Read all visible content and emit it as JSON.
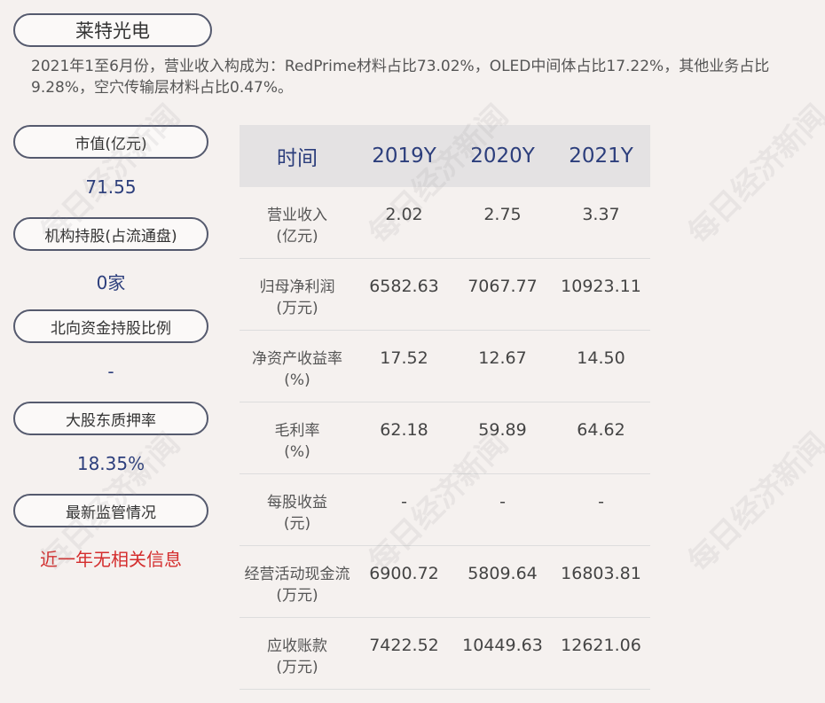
{
  "company": "莱特光电",
  "summary": "2021年1至6月份，营业收入构成为：RedPrime材料占比73.02%，OLED中间体占比17.22%，其他业务占比9.28%，空穴传输层材料占比0.47%。",
  "metrics": [
    {
      "label": "市值(亿元)",
      "value": "71.55"
    },
    {
      "label": "机构持股(占流通盘)",
      "value": "0家"
    },
    {
      "label": "北向资金持股比例",
      "value": "-"
    },
    {
      "label": "大股东质押率",
      "value": "18.35%"
    },
    {
      "label": "最新监管情况",
      "value": "近一年无相关信息"
    }
  ],
  "table": {
    "headers": [
      "时间",
      "2019Y",
      "2020Y",
      "2021Y"
    ],
    "rows": [
      {
        "label1": "营业收入",
        "label2": "(亿元)",
        "v": [
          "2.02",
          "2.75",
          "3.37"
        ]
      },
      {
        "label1": "归母净利润",
        "label2": "(万元)",
        "v": [
          "6582.63",
          "7067.77",
          "10923.11"
        ]
      },
      {
        "label1": "净资产收益率",
        "label2": "(%)",
        "v": [
          "17.52",
          "12.67",
          "14.50"
        ]
      },
      {
        "label1": "毛利率",
        "label2": "(%)",
        "v": [
          "62.18",
          "59.89",
          "64.62"
        ]
      },
      {
        "label1": "每股收益",
        "label2": "(元)",
        "v": [
          "-",
          "-",
          "-"
        ]
      },
      {
        "label1": "经营活动现金流",
        "label2": "(万元)",
        "v": [
          "6900.72",
          "5809.64",
          "16803.81"
        ]
      },
      {
        "label1": "应收账款",
        "label2": "(万元)",
        "v": [
          "7422.52",
          "10449.63",
          "12621.06"
        ]
      }
    ]
  },
  "watermark": "每日经济新闻"
}
